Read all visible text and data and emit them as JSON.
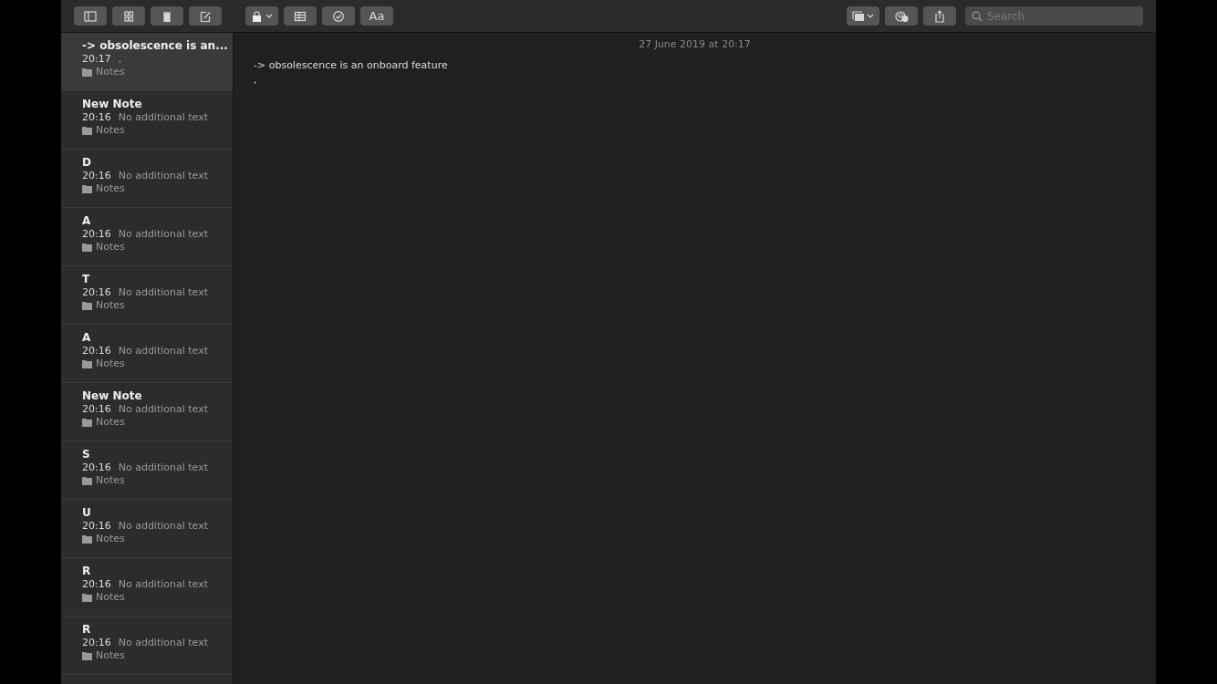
{
  "toolbar": {
    "format_button": "Aa",
    "search": {
      "placeholder": "Search"
    }
  },
  "notes": [
    {
      "title": "-> obsolescence is an...",
      "time": "20:17",
      "preview": ",",
      "folder": "Notes",
      "selected": true
    },
    {
      "title": "New Note",
      "time": "20:16",
      "preview": "No additional text",
      "folder": "Notes",
      "selected": false
    },
    {
      "title": "D",
      "time": "20:16",
      "preview": "No additional text",
      "folder": "Notes",
      "selected": false
    },
    {
      "title": "A",
      "time": "20:16",
      "preview": "No additional text",
      "folder": "Notes",
      "selected": false
    },
    {
      "title": "T",
      "time": "20:16",
      "preview": "No additional text",
      "folder": "Notes",
      "selected": false
    },
    {
      "title": "A",
      "time": "20:16",
      "preview": "No additional text",
      "folder": "Notes",
      "selected": false
    },
    {
      "title": "New Note",
      "time": "20:16",
      "preview": "No additional text",
      "folder": "Notes",
      "selected": false
    },
    {
      "title": "S",
      "time": "20:16",
      "preview": "No additional text",
      "folder": "Notes",
      "selected": false
    },
    {
      "title": "U",
      "time": "20:16",
      "preview": "No additional text",
      "folder": "Notes",
      "selected": false
    },
    {
      "title": "R",
      "time": "20:16",
      "preview": "No additional text",
      "folder": "Notes",
      "selected": false
    },
    {
      "title": "R",
      "time": "20:16",
      "preview": "No additional text",
      "folder": "Notes",
      "selected": false
    }
  ],
  "editor": {
    "date": "27 June 2019 at 20:17",
    "lines": [
      "-> obsolescence is an onboard feature",
      ","
    ]
  }
}
